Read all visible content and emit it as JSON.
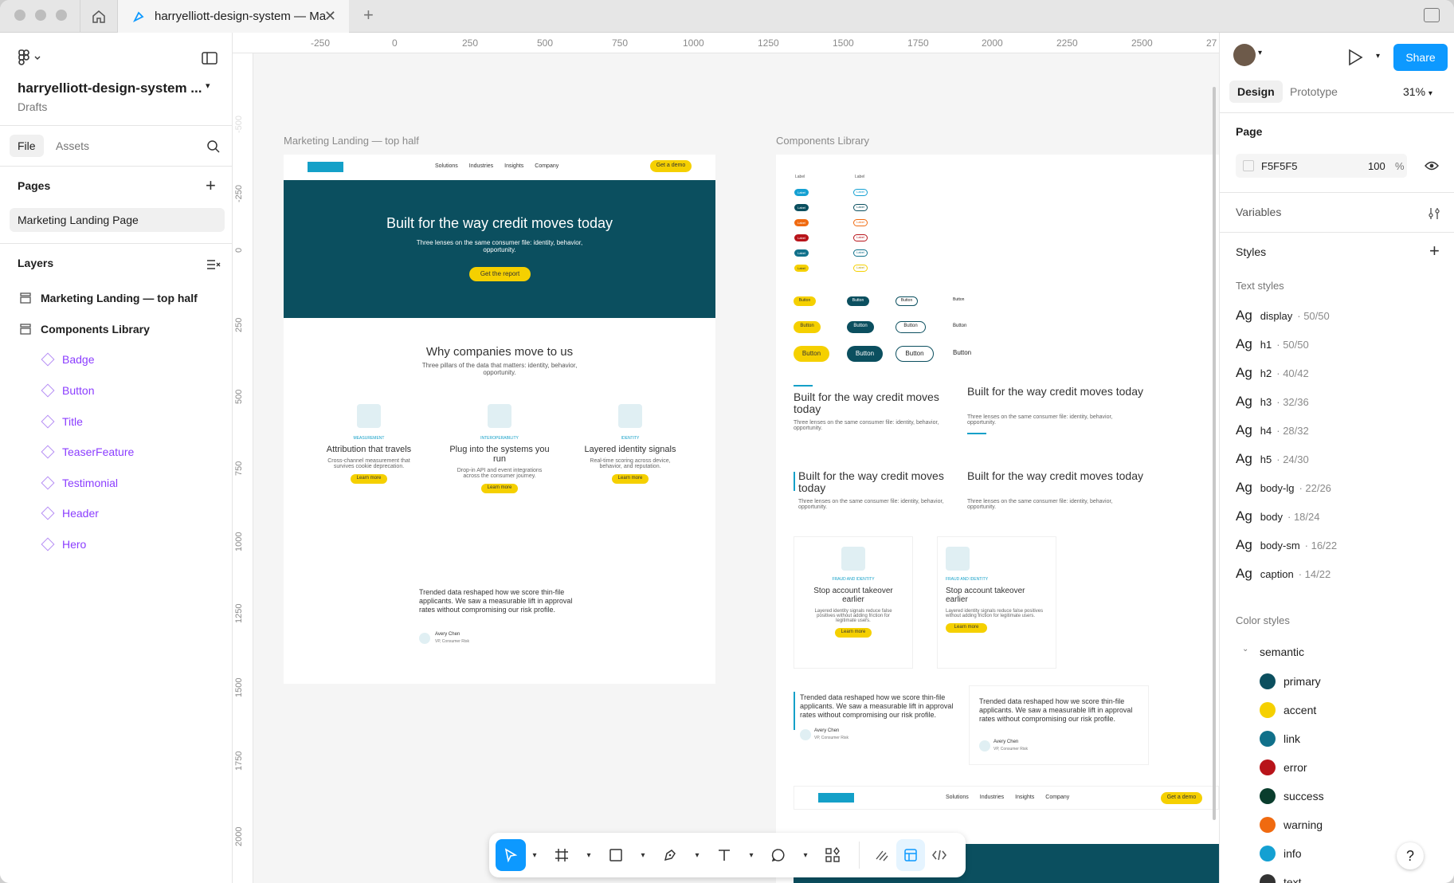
{
  "tab": {
    "title": "harryelliott-design-system — Ma"
  },
  "file": {
    "name": "harryelliott-design-system ...",
    "location": "Drafts"
  },
  "left_tabs": {
    "file": "File",
    "assets": "Assets"
  },
  "pages": {
    "header": "Pages",
    "items": [
      "Marketing Landing Page"
    ]
  },
  "layers": {
    "header": "Layers",
    "frames": [
      "Marketing Landing — top half",
      "Components Library"
    ],
    "components": [
      "Badge",
      "Button",
      "Title",
      "TeaserFeature",
      "Testimonial",
      "Header",
      "Hero"
    ]
  },
  "ruler": {
    "x": [
      "-250",
      "0",
      "250",
      "500",
      "750",
      "1000",
      "1250",
      "1500",
      "1750",
      "2000",
      "2250",
      "2500",
      "27"
    ],
    "y": [
      "-500",
      "-250",
      "0",
      "250",
      "500",
      "750",
      "1000",
      "1250",
      "1500",
      "1750",
      "2000"
    ]
  },
  "landing": {
    "label": "Marketing Landing — top half",
    "nav": [
      "Solutions",
      "Industries",
      "Insights",
      "Company"
    ],
    "nav_cta": "Get a demo",
    "hero_title": "Built for the way credit moves today",
    "hero_sub": "Three lenses on the same consumer file: identity, behavior, opportunity.",
    "hero_cta": "Get the report",
    "why_title": "Why companies move to us",
    "why_sub": "Three pillars of the data that matters: identity, behavior, opportunity.",
    "features": [
      {
        "eyebrow": "MEASUREMENT",
        "title": "Attribution that travels",
        "text": "Cross-channel measurement that survives cookie deprecation.",
        "cta": "Learn more"
      },
      {
        "eyebrow": "INTEROPERABILITY",
        "title": "Plug into the systems you run",
        "text": "Drop-in API and event integrations across the consumer journey.",
        "cta": "Learn more"
      },
      {
        "eyebrow": "IDENTITY",
        "title": "Layered identity signals",
        "text": "Real-time scoring across device, behavior, and reputation.",
        "cta": "Learn more"
      }
    ],
    "quote": "Trended data reshaped how we score thin-file applicants. We saw a measurable lift in approval rates without compromising our risk profile.",
    "author": "Avery Chen",
    "role": "VP, Consumer Risk"
  },
  "library": {
    "label": "Components Library",
    "badge_label": "Label",
    "button_label": "Button",
    "title_text": "Built for the way credit moves today",
    "title_sub": "Three lenses on the same consumer file: identity, behavior, opportunity.",
    "teaser": {
      "eyebrow": "FRAUD AND IDENTITY",
      "title": "Stop account takeover earlier",
      "text": "Layered identity signals reduce false positives without adding friction for legitimate users.",
      "cta": "Learn more"
    },
    "quote": "Trended data reshaped how we score thin-file applicants. We saw a measurable lift in approval rates without compromising our risk profile.",
    "author": "Avery Chen",
    "role": "VP, Consumer Risk",
    "nav": [
      "Solutions",
      "Industries",
      "Insights",
      "Company"
    ],
    "nav_cta": "Get a demo"
  },
  "right": {
    "share": "Share",
    "tabs": {
      "design": "Design",
      "prototype": "Prototype"
    },
    "zoom": "31%",
    "page_header": "Page",
    "page_fill": "F5F5F5",
    "page_opacity": "100",
    "percent": "%",
    "variables": "Variables",
    "styles": "Styles",
    "text_styles_header": "Text styles",
    "text_styles": [
      {
        "ag": "Ag",
        "name": "display",
        "meta": "· 50/50"
      },
      {
        "ag": "Ag",
        "name": "h1",
        "meta": "· 50/50"
      },
      {
        "ag": "Ag",
        "name": "h2",
        "meta": "· 40/42"
      },
      {
        "ag": "Ag",
        "name": "h3",
        "meta": "· 32/36"
      },
      {
        "ag": "Ag",
        "name": "h4",
        "meta": "· 28/32"
      },
      {
        "ag": "Ag",
        "name": "h5",
        "meta": "· 24/30"
      },
      {
        "ag": "Ag",
        "name": "body-lg",
        "meta": "· 22/26"
      },
      {
        "ag": "Ag",
        "name": "body",
        "meta": "· 18/24"
      },
      {
        "ag": "Ag",
        "name": "body-sm",
        "meta": "· 16/22"
      },
      {
        "ag": "Ag",
        "name": "caption",
        "meta": "· 14/22"
      }
    ],
    "color_styles_header": "Color styles",
    "color_group": "semantic",
    "colors": [
      {
        "name": "primary",
        "hex": "#0b4f5f"
      },
      {
        "name": "accent",
        "hex": "#f5d000"
      },
      {
        "name": "link",
        "hex": "#10708a"
      },
      {
        "name": "error",
        "hex": "#b8141a"
      },
      {
        "name": "success",
        "hex": "#0a3d2d"
      },
      {
        "name": "warning",
        "hex": "#f06a10"
      },
      {
        "name": "info",
        "hex": "#14a0d2"
      },
      {
        "name": "text",
        "hex": "#333333"
      }
    ]
  }
}
